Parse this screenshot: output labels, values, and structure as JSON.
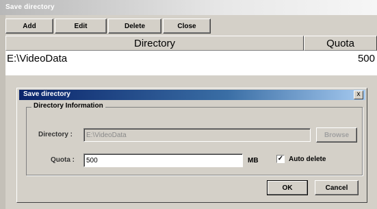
{
  "outer_window": {
    "title": "Save directory",
    "toolbar": {
      "add": "Add",
      "edit": "Edit",
      "delete": "Delete",
      "close": "Close"
    },
    "table": {
      "columns": [
        "Directory",
        "Quota"
      ],
      "rows": [
        {
          "directory": "E:\\VideoData",
          "quota": "500"
        }
      ]
    }
  },
  "dialog": {
    "title": "Save directory",
    "close_glyph": "x",
    "group_label": "Directory Information",
    "directory_label": "Directory :",
    "directory_value": "E:\\VideoData",
    "browse_label": "Browse",
    "quota_label": "Quota :",
    "quota_value": "500",
    "quota_unit": "MB",
    "auto_delete_label": "Auto delete",
    "auto_delete_checked": true,
    "ok_label": "OK",
    "cancel_label": "Cancel"
  },
  "colors": {
    "face": "#d4d0c8",
    "active_title_start": "#0a246a",
    "active_title_end": "#a6caf0"
  }
}
